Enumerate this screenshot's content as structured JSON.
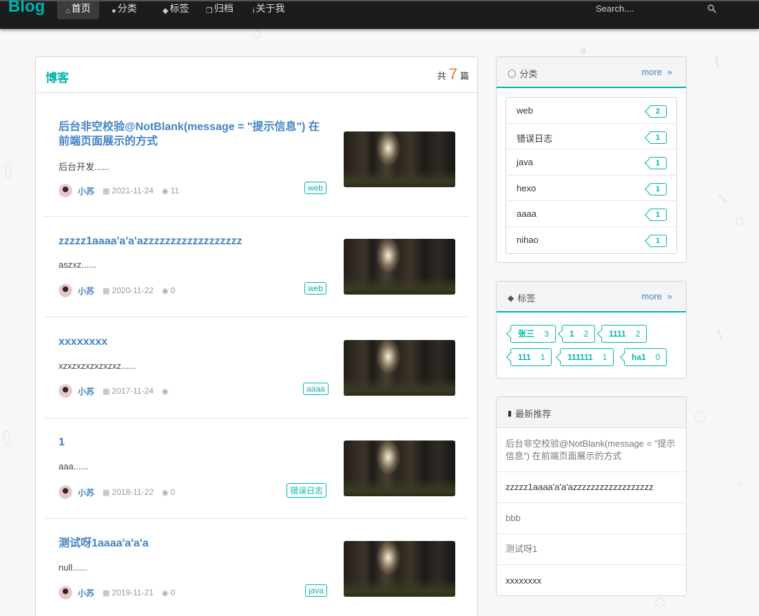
{
  "nav": {
    "brand": "Blog",
    "items": [
      {
        "icon": "home-icon",
        "label": "首页",
        "active": true
      },
      {
        "icon": "lightbulb-icon",
        "label": "分类",
        "active": false
      },
      {
        "icon": "tags-icon",
        "label": "标签",
        "active": false
      },
      {
        "icon": "clone-icon",
        "label": "归档",
        "active": false
      },
      {
        "icon": "info-icon",
        "label": "关于我",
        "active": false
      }
    ],
    "search_placeholder": "Search...."
  },
  "main": {
    "title": "博客",
    "count_prefix": "共",
    "count": "7",
    "count_suffix": "篇",
    "posts": [
      {
        "title": "后台非空校验@NotBlank(message = \"提示信息\") 在前端页面展示的方式",
        "excerpt": "后台开发......",
        "author": "小苏",
        "date": "2021-11-24",
        "views": "11",
        "tag": "web"
      },
      {
        "title": "zzzzz1aaaa'a'a'azzzzzzzzzzzzzzzzzz",
        "excerpt": "aszxz......",
        "author": "小苏",
        "date": "2020-11-22",
        "views": "0",
        "tag": "web"
      },
      {
        "title": "xxxxxxxx",
        "excerpt": "xzxzxzxzxzxzxz......",
        "author": "小苏",
        "date": "2017-11-24",
        "views": "",
        "tag": "aaaa"
      },
      {
        "title": "1",
        "excerpt": "aaa......",
        "author": "小苏",
        "date": "2018-11-22",
        "views": "0",
        "tag": "错误日志"
      },
      {
        "title": "测试呀1aaaa'a'a'a",
        "excerpt": "null......",
        "author": "小苏",
        "date": "2019-11-21",
        "views": "0",
        "tag": "java"
      }
    ]
  },
  "sidebar": {
    "categories": {
      "title": "分类",
      "more": "more",
      "items": [
        {
          "name": "web",
          "count": "2"
        },
        {
          "name": "错误日志",
          "count": "1"
        },
        {
          "name": "java",
          "count": "1"
        },
        {
          "name": "hexo",
          "count": "1"
        },
        {
          "name": "aaaa",
          "count": "1"
        },
        {
          "name": "nihao",
          "count": "1"
        }
      ]
    },
    "tags": {
      "title": "标签",
      "more": "more",
      "items": [
        {
          "name": "张三",
          "count": "3"
        },
        {
          "name": "1",
          "count": "2"
        },
        {
          "name": "1111",
          "count": "2"
        },
        {
          "name": "111",
          "count": "1"
        },
        {
          "name": "111111",
          "count": "1"
        },
        {
          "name": "ha1",
          "count": "0"
        }
      ]
    },
    "recommend": {
      "title": "最新推荐",
      "items": [
        "后台非空校验@NotBlank(message = \"提示信息\") 在前端页面展示的方式",
        "zzzzz1aaaa'a'a'azzzzzzzzzzzzzzzzzz",
        "bbb",
        "测试呀1",
        "xxxxxxxx"
      ]
    }
  },
  "colors": {
    "accent": "#00b5ad",
    "link": "#4183c4",
    "count": "#f2711c",
    "navbar": "#1b1c1d"
  }
}
